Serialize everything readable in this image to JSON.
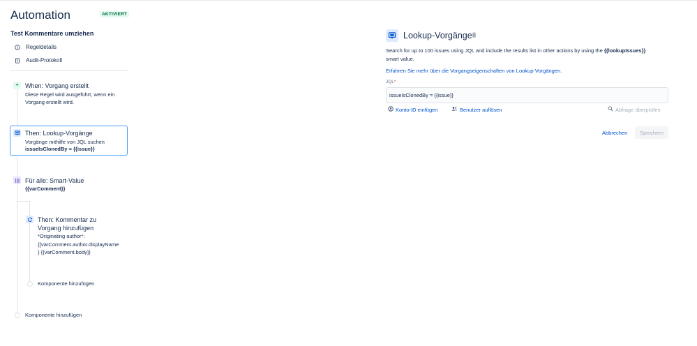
{
  "header": {
    "title": "Automation",
    "status_badge": "AKTIVIERT"
  },
  "rule": {
    "name": "Test Kommentare umziehen",
    "menu": [
      {
        "label": "Regeldetails",
        "icon": "info-icon"
      },
      {
        "label": "Audit-Protokoll",
        "icon": "document-icon"
      }
    ]
  },
  "flow": {
    "trigger": {
      "title": "When: Vorgang erstellt",
      "desc_line1": "Diese Regel wird ausgeführt, wenn ein",
      "desc_line2": "Vorgang erstellt wird.",
      "icon": "plus-icon"
    },
    "lookup": {
      "title": "Then: Lookup-Vorgänge",
      "desc": "Vorgänge mithilfe von JQL suchen",
      "query": "issueIsClonedBy = {{issue}}",
      "icon": "lookup-icon"
    },
    "branch": {
      "title": "Für alle: Smart-Value",
      "value": "{{varComment}}",
      "icon": "list-icon"
    },
    "comment": {
      "title_line1": "Then: Kommentar zu",
      "title_line2": "Vorgang hinzufügen",
      "desc_line1": "*Originating author*:",
      "desc_line2": "{{varComment.author.displayName",
      "desc_line3": "} {{varComment.body}}",
      "icon": "comment-icon"
    },
    "add_component_inner": "Komponente hinzufügen",
    "add_component_outer": "Komponente hinzufügen"
  },
  "panel": {
    "title": "Lookup-Vorgänge",
    "description_pre": "Search for up to 100 issues using JQL and include the results list in other actions by using the ",
    "description_bold": "{{lookupIssues}}",
    "description_post": "smart value.",
    "learn_more": "Erfahren Sie mehr über die Vorgangseigenschaften von Lookup-Vorgängen.",
    "jql_label": "JQL",
    "jql_required": "*",
    "jql_value": "issueIsClonedBy = {{issue}}",
    "insert_account": "Konto-ID einfügen",
    "resolve_users": "Benutzer auflösen",
    "check_query": "Abfrage überprüfen",
    "cancel": "Abbrechen",
    "save": "Speichern"
  },
  "colors": {
    "accent": "#0052cc",
    "selected_border": "#4c9aff",
    "badge_green": "#006644"
  }
}
